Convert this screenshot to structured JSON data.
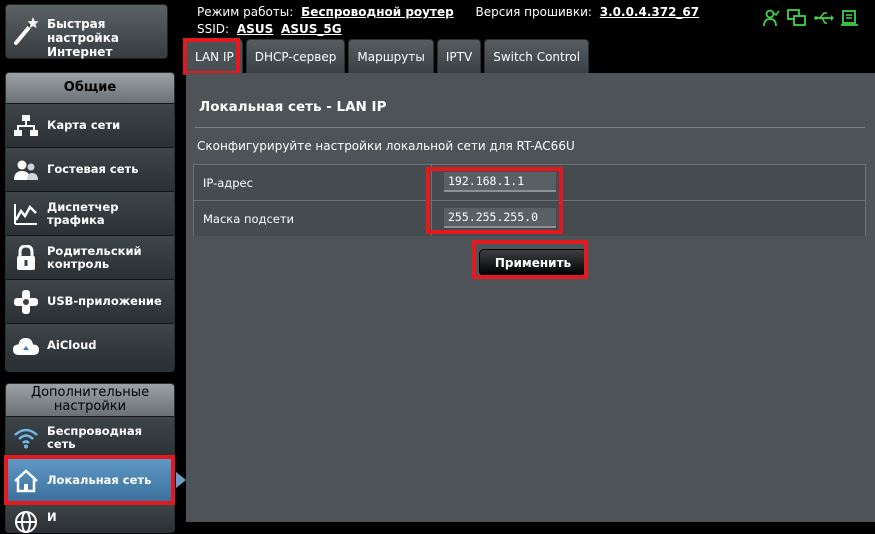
{
  "quick_setup": {
    "label": "Быстрая настройка Интернет",
    "icon": "magic-wand-icon"
  },
  "general": {
    "title": "Общие",
    "items": [
      {
        "label": "Карта сети",
        "icon": "network-map-icon"
      },
      {
        "label": "Гостевая сеть",
        "icon": "guest-network-icon"
      },
      {
        "label": "Диспетчер трафика",
        "icon": "traffic-manager-icon"
      },
      {
        "label": "Родительский контроль",
        "icon": "parental-control-icon"
      },
      {
        "label": "USB-приложение",
        "icon": "usb-application-icon"
      },
      {
        "label": "AiCloud",
        "icon": "aicloud-icon"
      }
    ]
  },
  "advanced": {
    "title": "Дополнительные настройки",
    "items": [
      {
        "label": "Беспроводная сеть",
        "icon": "wireless-icon"
      },
      {
        "label": "Локальная сеть",
        "icon": "lan-home-icon"
      },
      {
        "label": "И",
        "icon": "globe-icon"
      }
    ]
  },
  "header": {
    "mode_label": "Режим работы:",
    "mode_value": "Беспроводной роутер",
    "firmware_label": "Версия прошивки:",
    "firmware_value": "3.0.0.4.372_67",
    "ssid_label": "SSID:",
    "ssid_values": [
      "ASUS",
      "ASUS_5G"
    ]
  },
  "tabs": [
    {
      "label": "LAN IP",
      "active": true
    },
    {
      "label": "DHCP-сервер"
    },
    {
      "label": "Маршруты"
    },
    {
      "label": "IPTV"
    },
    {
      "label": "Switch Control"
    }
  ],
  "content": {
    "title": "Локальная сеть - LAN IP",
    "description": "Сконфигурируйте настройки локальной сети для RT-AC66U",
    "fields": [
      {
        "label": "IP-адрес",
        "value": "192.168.1.1"
      },
      {
        "label": "Маска подсети",
        "value": "255.255.255.0"
      }
    ],
    "apply_label": "Применить"
  },
  "colors": {
    "highlight": "#e21a1f",
    "status_icon": "#3fd44a",
    "active_menu": "#4a82b0"
  }
}
